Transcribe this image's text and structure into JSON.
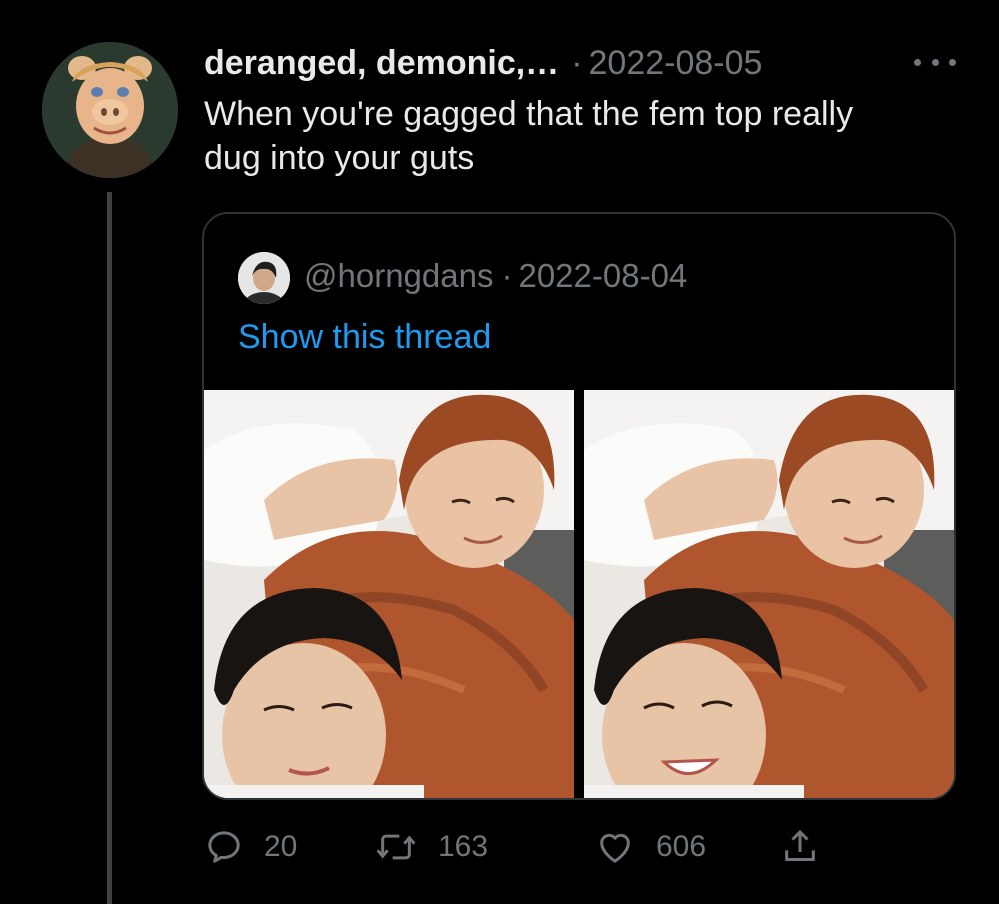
{
  "tweet": {
    "display_name": "deranged, demonic,…",
    "separator": "·",
    "date": "2022-08-05",
    "text": "When you're gagged that the fem top really dug into your guts",
    "avatar_icon": "muppet-portrait-avatar",
    "more_icon": "more-horizontal-icon"
  },
  "quote": {
    "handle": "@horngdans",
    "separator": "·",
    "date": "2022-08-04",
    "show_thread_label": "Show this thread",
    "avatar_icon": "user-portrait-avatar",
    "photos": [
      "selfie-photo-1",
      "selfie-photo-2"
    ]
  },
  "actions": {
    "reply": {
      "icon": "reply-icon",
      "count": "20"
    },
    "retweet": {
      "icon": "retweet-icon",
      "count": "163"
    },
    "like": {
      "icon": "heart-icon",
      "count": "606"
    },
    "share": {
      "icon": "share-icon"
    }
  },
  "colors": {
    "background": "#000000",
    "text_primary": "#e7e9ea",
    "text_secondary": "#71767b",
    "link": "#1d9bf0",
    "border": "#2f3336",
    "thread_line": "#3e4144"
  }
}
